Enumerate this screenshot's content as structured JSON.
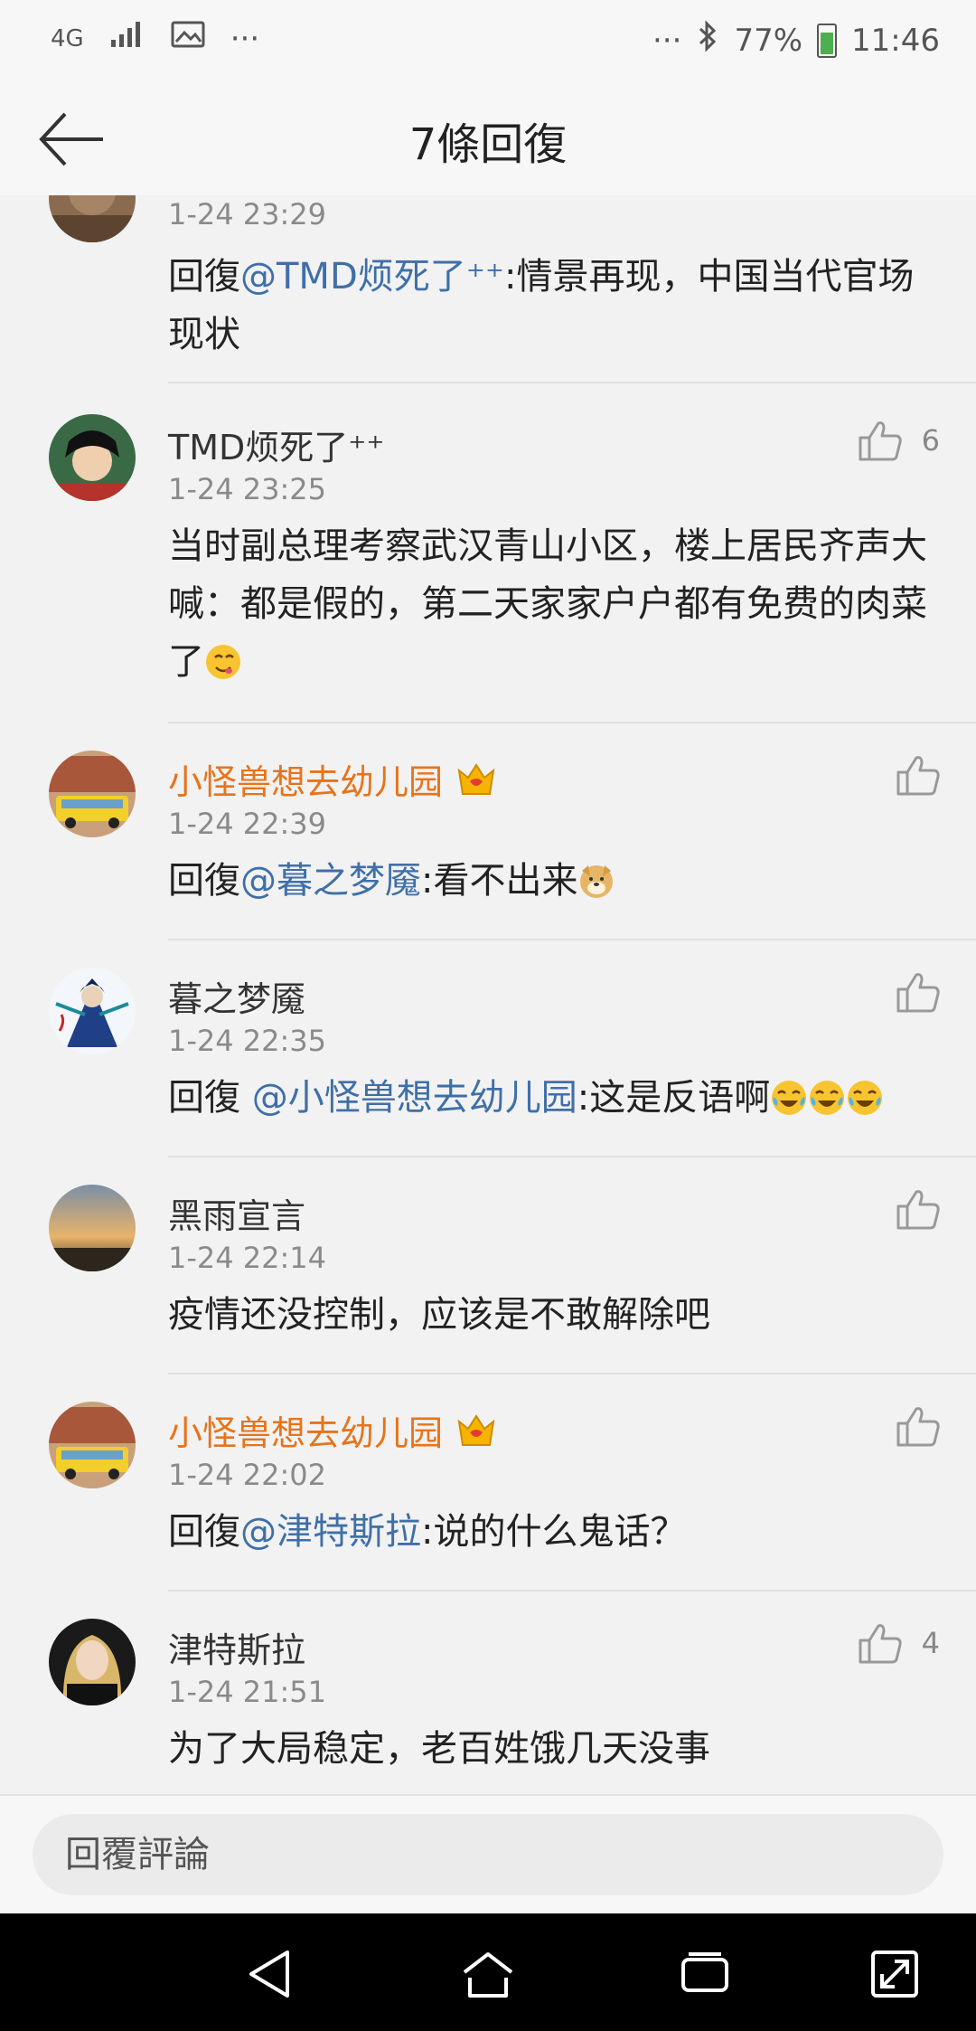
{
  "status_bar": {
    "network": "4G",
    "more": "···",
    "more_right": "···",
    "battery": "77%",
    "time": "11:46"
  },
  "header": {
    "title": "7條回復"
  },
  "comments": [
    {
      "username": "",
      "time": "1-24 23:29",
      "reply_prefix": "回復",
      "mention": "@TMD烦死了⁺⁺",
      "text": ":情景再现，中国当代官场现状"
    },
    {
      "username": "TMD烦死了⁺⁺",
      "time": "1-24 23:25",
      "text": "当时副总理考察武汉青山小区，楼上居民齐声大喊：都是假的，第二天家家户户都有免费的肉菜了",
      "likes": "6"
    },
    {
      "username": "小怪兽想去幼儿园",
      "vip": true,
      "time": "1-24 22:39",
      "reply_prefix": "回復",
      "mention": "@暮之梦魇",
      "text": ":看不出来"
    },
    {
      "username": "暮之梦魇",
      "time": "1-24 22:35",
      "reply_prefix": "回復 ",
      "mention": "@小怪兽想去幼儿园",
      "text": ":这是反语啊"
    },
    {
      "username": "黑雨宣言",
      "time": "1-24 22:14",
      "text": "疫情还没控制，应该是不敢解除吧"
    },
    {
      "username": "小怪兽想去幼儿园",
      "vip": true,
      "time": "1-24 22:02",
      "reply_prefix": "回復",
      "mention": "@津特斯拉",
      "text": ":说的什么鬼话？"
    },
    {
      "username": "津特斯拉",
      "time": "1-24 21:51",
      "text": "为了大局稳定，老百姓饿几天没事",
      "likes": "4"
    }
  ],
  "composer": {
    "placeholder": "回覆評論"
  },
  "icons": {
    "back": "arrow-left-icon",
    "like": "thumbs-up-icon",
    "vip": "crown-badge-icon",
    "nav_back": "triangle-back-icon",
    "nav_home": "home-icon",
    "nav_recents": "recents-icon",
    "nav_expand": "expand-icon"
  },
  "colors": {
    "mention": "#3f6fa8",
    "vip_name": "#e8731a",
    "timestamp": "#8a8a8a",
    "background": "#f2f2f2"
  }
}
